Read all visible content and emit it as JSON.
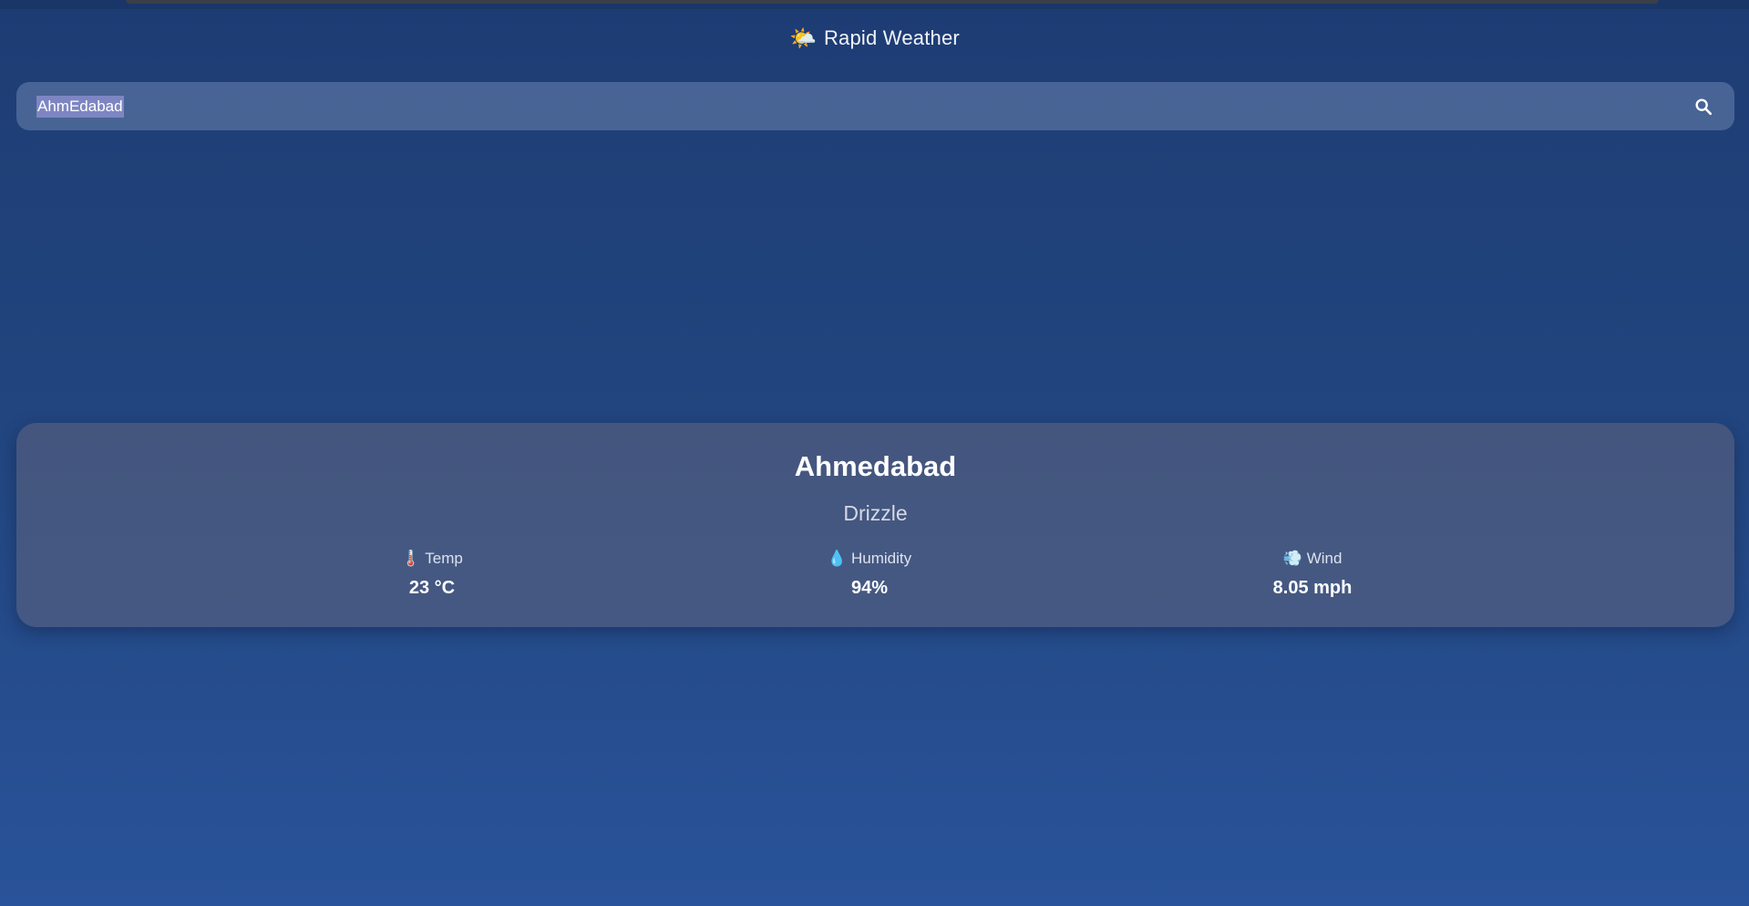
{
  "app": {
    "logo_icon": "sun-behind-cloud-icon",
    "logo_glyph": "🌤️",
    "title": "Rapid Weather"
  },
  "search": {
    "value": "AhmEdabad",
    "placeholder": "",
    "button_icon": "search-icon"
  },
  "weather": {
    "city": "Ahmedabad",
    "condition": "Drizzle",
    "stats": [
      {
        "icon": "thermometer-icon",
        "glyph": "🌡️",
        "label": "Temp",
        "value": "23 °C"
      },
      {
        "icon": "droplet-icon",
        "glyph": "💧",
        "label": "Humidity",
        "value": "94%"
      },
      {
        "icon": "wind-icon",
        "glyph": "💨",
        "label": "Wind",
        "value": "8.05 mph"
      }
    ]
  },
  "colors": {
    "background_top": "#1e3c74",
    "background_bottom": "#29539a",
    "selection_highlight": "#7d86c2"
  }
}
